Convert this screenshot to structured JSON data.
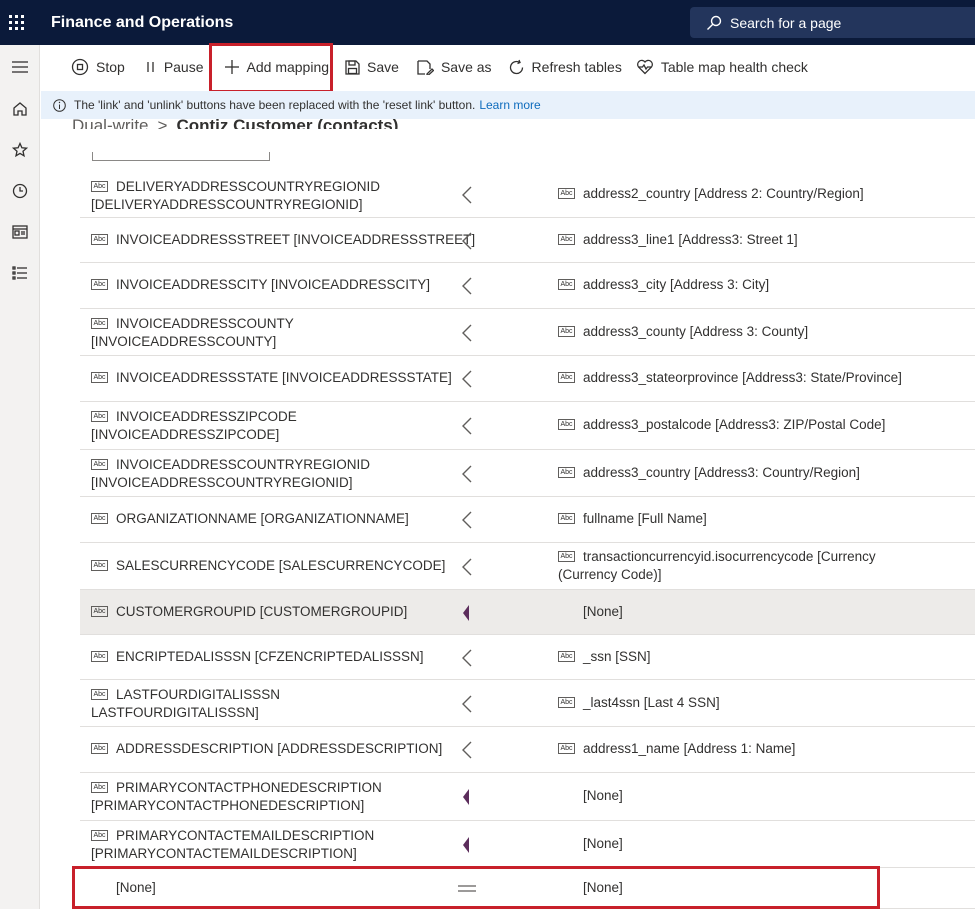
{
  "app": {
    "title": "Finance and Operations",
    "search_placeholder": "Search for a page"
  },
  "actions": {
    "stop": "Stop",
    "pause": "Pause",
    "add_mapping": "Add mapping",
    "save": "Save",
    "save_as": "Save as",
    "refresh_tables": "Refresh tables",
    "health_check": "Table map health check"
  },
  "info": {
    "message": "The 'link' and 'unlink' buttons have been replaced with the 'reset link' button.",
    "link": "Learn more"
  },
  "breadcrumb": {
    "parent": "Dual-write",
    "separator": ">",
    "current": "Contiz Customer (contacts)"
  },
  "rows": [
    {
      "src1": "DELIVERYADDRESSCOUNTRYREGIONID",
      "src2": "[DELIVERYADDRESSCOUNTRYREGIONID]",
      "dst1": "address2_country [Address 2: Country/Region]",
      "dst2": "",
      "dir": "left"
    },
    {
      "src1": "INVOICEADDRESSSTREET [INVOICEADDRESSSTREET]",
      "src2": "",
      "dst1": "address3_line1 [Address3: Street 1]",
      "dst2": "",
      "dir": "left"
    },
    {
      "src1": "INVOICEADDRESSCITY [INVOICEADDRESSCITY]",
      "src2": "",
      "dst1": "address3_city [Address 3: City]",
      "dst2": "",
      "dir": "left"
    },
    {
      "src1": "INVOICEADDRESSCOUNTY",
      "src2": "[INVOICEADDRESSCOUNTY]",
      "dst1": "address3_county [Address 3: County]",
      "dst2": "",
      "dir": "left"
    },
    {
      "src1": "INVOICEADDRESSSTATE [INVOICEADDRESSSTATE]",
      "src2": "",
      "dst1": "address3_stateorprovince [Address3: State/Province]",
      "dst2": "",
      "dir": "left"
    },
    {
      "src1": "INVOICEADDRESSZIPCODE",
      "src2": "[INVOICEADDRESSZIPCODE]",
      "dst1": "address3_postalcode [Address3: ZIP/Postal Code]",
      "dst2": "",
      "dir": "left"
    },
    {
      "src1": "INVOICEADDRESSCOUNTRYREGIONID",
      "src2": "[INVOICEADDRESSCOUNTRYREGIONID]",
      "dst1": "address3_country [Address3: Country/Region]",
      "dst2": "",
      "dir": "left"
    },
    {
      "src1": "ORGANIZATIONNAME [ORGANIZATIONNAME]",
      "src2": "",
      "dst1": "fullname [Full Name]",
      "dst2": "",
      "dir": "left"
    },
    {
      "src1": "SALESCURRENCYCODE [SALESCURRENCYCODE]",
      "src2": "",
      "dst1": "transactioncurrencyid.isocurrencycode [Currency",
      "dst2": "(Currency Code)]",
      "dir": "left"
    },
    {
      "src1": "CUSTOMERGROUPID [CUSTOMERGROUPID]",
      "src2": "",
      "dst1": "[None]",
      "dst2": "",
      "dir": "filled"
    },
    {
      "src1": "ENCRIPTEDALISSSN [CFZENCRIPTEDALISSSN]",
      "src2": "",
      "dst1": "_ssn [SSN]",
      "dst2": "",
      "dir": "left"
    },
    {
      "src1": "LASTFOURDIGITALISSSN",
      "src2": "LASTFOURDIGITALISSSN]",
      "dst1": "_last4ssn [Last 4 SSN]",
      "dst2": "",
      "dir": "left"
    },
    {
      "src1": "ADDRESSDESCRIPTION [ADDRESSDESCRIPTION]",
      "src2": "",
      "dst1": "address1_name [Address 1: Name]",
      "dst2": "",
      "dir": "left"
    },
    {
      "src1": "PRIMARYCONTACTPHONEDESCRIPTION",
      "src2": "[PRIMARYCONTACTPHONEDESCRIPTION]",
      "dst1": "[None]",
      "dst2": "",
      "dir": "filled"
    },
    {
      "src1": "PRIMARYCONTACTEMAILDESCRIPTION",
      "src2": "[PRIMARYCONTACTEMAILDESCRIPTION]",
      "dst1": "[None]",
      "dst2": "",
      "dir": "filled"
    },
    {
      "src1": "[None]",
      "src2": "",
      "dst1": "[None]",
      "dst2": "",
      "dir": "equal"
    }
  ],
  "icons": {
    "field_type": "Abc"
  },
  "colors": {
    "topbar": "#0b1a3a",
    "highlight": "#c8202a",
    "info_bg": "#e8f1fb",
    "arrow_filled": "#5c2d5c"
  }
}
